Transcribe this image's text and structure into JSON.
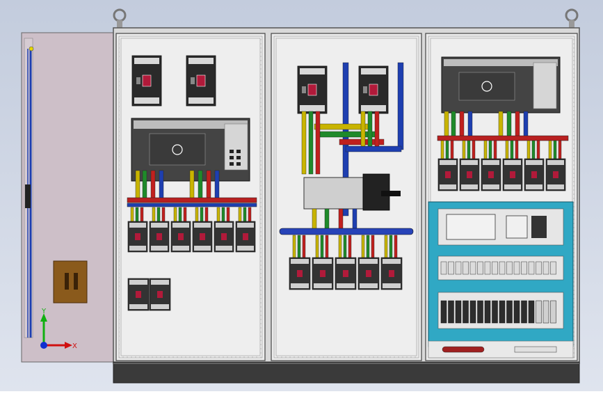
{
  "viewport": {
    "background_top": "#c3ccdd",
    "background_bottom": "#dfe4ee"
  },
  "cabinet": {
    "frame_color": "#d9d9d9",
    "plinth_color": "#3a3a3a",
    "door_color": "#cdbfc8",
    "wire_colors": {
      "L1": "#c8b400",
      "L2": "#1f8a2a",
      "L3": "#c0201e",
      "N": "#1e3fb0",
      "PE": "#e6d700"
    },
    "module_color": "#2a2a2a",
    "plc_panel_color": "#30a8c4",
    "lifting_eye_count": 2,
    "sections": [
      "left-section",
      "middle-section",
      "right-section"
    ]
  },
  "triad": {
    "x_label": "X",
    "y_label": "Y",
    "x_color": "#d01010",
    "y_color": "#10b010",
    "z_color": "#1030d0"
  }
}
